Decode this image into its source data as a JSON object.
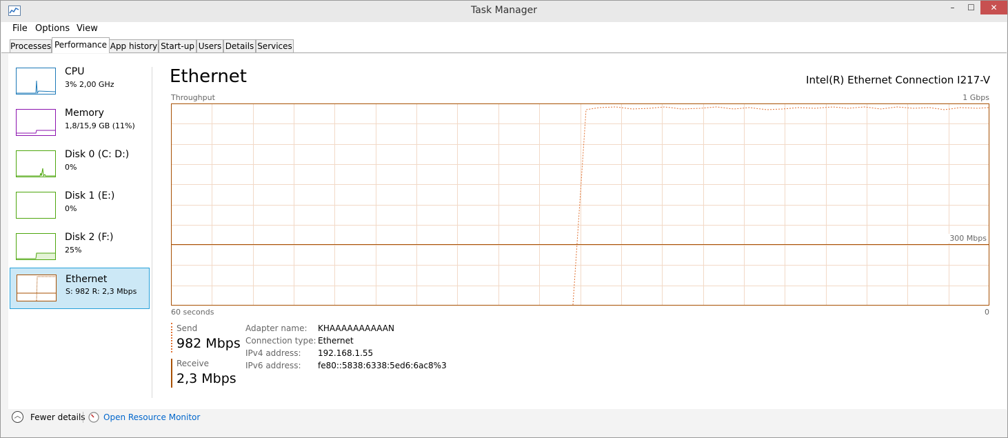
{
  "window": {
    "title": "Task Manager",
    "min": "–",
    "max": "☐",
    "close": "✕"
  },
  "menu": [
    "File",
    "Options",
    "View"
  ],
  "tabs": [
    "Processes",
    "Performance",
    "App history",
    "Start-up",
    "Users",
    "Details",
    "Services"
  ],
  "active_tab": "Performance",
  "sidebar": [
    {
      "name": "CPU",
      "value": "3% 2,00 GHz",
      "color": "#1b78b7"
    },
    {
      "name": "Memory",
      "value": "1,8/15,9 GB (11%)",
      "color": "#8b12ae"
    },
    {
      "name": "Disk 0 (C: D:)",
      "value": "0%",
      "color": "#4da60c"
    },
    {
      "name": "Disk 1 (E:)",
      "value": "0%",
      "color": "#4da60c"
    },
    {
      "name": "Disk 2 (F:)",
      "value": "25%",
      "color": "#4da60c"
    },
    {
      "name": "Ethernet",
      "value": "S: 982 R: 2,3 Mbps",
      "color": "#a74f01",
      "active": true
    }
  ],
  "detail": {
    "title": "Ethernet",
    "adapter": "Intel(R) Ethernet Connection I217-V",
    "graph_label": "Throughput",
    "max_label": "1 Gbps",
    "mid_label": "300 Mbps",
    "time_label": "60 seconds",
    "zero_label": "0"
  },
  "stats": {
    "send_label": "Send",
    "send_value": "982 Mbps",
    "receive_label": "Receive",
    "receive_value": "2,3 Mbps"
  },
  "properties": [
    {
      "key": "Adapter name:",
      "value": "KHAAAAAAAAAAN"
    },
    {
      "key": "Connection type:",
      "value": "Ethernet"
    },
    {
      "key": "IPv4 address:",
      "value": "192.168.1.55"
    },
    {
      "key": "IPv6 address:",
      "value": "fe80::5838:6338:5ed6:6ac8%3"
    }
  ],
  "footer": {
    "fewer_details": "Fewer details",
    "open_resource_monitor": "Open Resource Monitor"
  },
  "colors": {
    "ethernet": "#a74f01",
    "grid": "#f2d9c7",
    "selection": "#cce8f6",
    "link": "#0066cc"
  }
}
